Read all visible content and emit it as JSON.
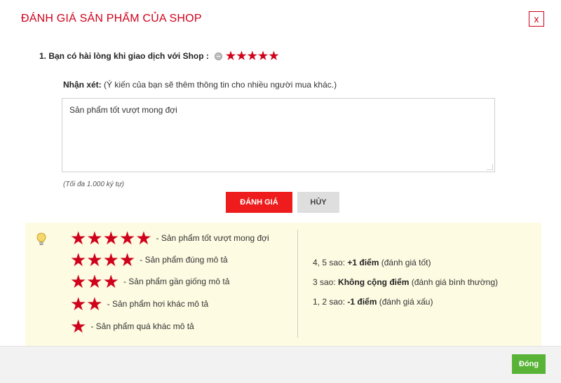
{
  "dialog": {
    "title": "ĐÁNH GIÁ SẢN PHẨM CỦA SHOP",
    "close_label": "x"
  },
  "question1": {
    "label": "1. Bạn có hài lòng khi giao dịch với Shop :",
    "rating": 5,
    "max_rating": 5
  },
  "comment": {
    "label_bold": "Nhận xét:",
    "label_hint": " (Ý kiến của bạn sẽ thêm thông tin cho nhiều người mua khác.)",
    "value": "Sản phẩm tốt vượt mong đợi",
    "max_chars_note": "(Tối đa 1.000 ký tự)"
  },
  "buttons": {
    "submit": "ĐÁNH GIÁ",
    "cancel": "HỦY",
    "close": "Đóng"
  },
  "legend": [
    {
      "stars": 5,
      "text": "- Sản phẩm tốt vượt mong đợi"
    },
    {
      "stars": 4,
      "text": "- Sản phẩm đúng mô tả"
    },
    {
      "stars": 3,
      "text": "- Sản phẩm gần giống mô tả"
    },
    {
      "stars": 2,
      "text": "- Sản phẩm hơi khác mô tả"
    },
    {
      "stars": 1,
      "text": "- Sản phẩm quá khác mô tả"
    }
  ],
  "rules": [
    {
      "prefix": "4, 5 sao: ",
      "bold": "+1 điểm",
      "suffix": " (đánh giá tốt)"
    },
    {
      "prefix": "3 sao: ",
      "bold": "Không cộng điểm",
      "suffix": " (đánh giá bình thường)"
    },
    {
      "prefix": "1, 2 sao: ",
      "bold": "-1 điểm",
      "suffix": " (đánh giá xấu)"
    }
  ],
  "colors": {
    "accent_red": "#d0021b",
    "info_bg": "#fdfbe2",
    "close_green": "#59b337"
  },
  "icons": {
    "close": "close-icon",
    "star": "star-icon",
    "reset": "reset-rating-icon",
    "tip": "lightbulb-icon"
  }
}
